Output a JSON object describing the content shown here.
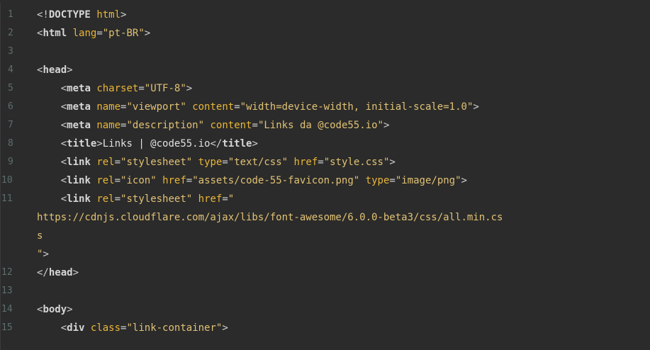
{
  "editor": {
    "lines": [
      {
        "num": "1",
        "text": "<!DOCTYPE html>"
      },
      {
        "num": "2",
        "text": "<html lang=\"pt-BR\">"
      },
      {
        "num": "3",
        "text": ""
      },
      {
        "num": "4",
        "text": "<head>"
      },
      {
        "num": "5",
        "text": "    <meta charset=\"UTF-8\">"
      },
      {
        "num": "6",
        "text": "    <meta name=\"viewport\" content=\"width=device-width, initial-scale=1.0\">"
      },
      {
        "num": "7",
        "text": "    <meta name=\"description\" content=\"Links da @code55.io\">"
      },
      {
        "num": "8",
        "text": "    <title>Links | @code55.io</title>"
      },
      {
        "num": "9",
        "text": "    <link rel=\"stylesheet\" type=\"text/css\" href=\"style.css\">"
      },
      {
        "num": "10",
        "text": "    <link rel=\"icon\" href=\"assets/code-55-favicon.png\" type=\"image/png\">"
      },
      {
        "num": "11",
        "text": "    <link rel=\"stylesheet\" href=\""
      },
      {
        "num": "",
        "text": "https://cdnjs.cloudflare.com/ajax/libs/font-awesome/6.0.0-beta3/css/all.min.cs"
      },
      {
        "num": "",
        "text": "s"
      },
      {
        "num": "",
        "text": "\">"
      },
      {
        "num": "12",
        "text": "</head>"
      },
      {
        "num": "13",
        "text": ""
      },
      {
        "num": "14",
        "text": "<body>"
      },
      {
        "num": "15",
        "text": "    <div class=\"link-container\">"
      }
    ]
  },
  "colors": {
    "background": "#2b2b2b",
    "line_number": "#5e6e6e",
    "tag": "#d6d6d6",
    "attribute": "#e9b638",
    "string": "#e1c275",
    "text": "#e0e0e0"
  }
}
